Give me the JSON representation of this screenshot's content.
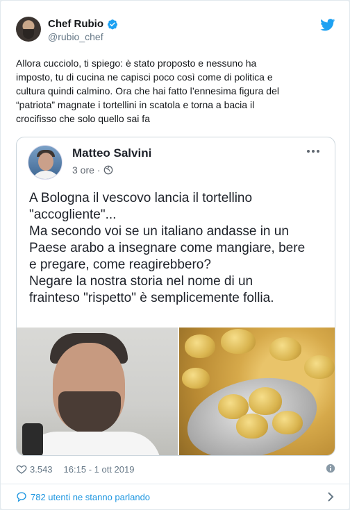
{
  "author": {
    "name": "Chef Rubio",
    "handle": "@rubio_chef",
    "verified": true
  },
  "tweet": {
    "lines": [
      "Allora cucciolo, ti spiego: è stato proposto e nessuno ha",
      "imposto, tu di cucina ne capisci poco così come di politica e",
      "cultura quindi calmino. Ora che hai fatto l’ennesima figura del",
      "“patriota” magnate i tortellini in scatola e torna a bacia il",
      "crocifisso che solo quello sai fa"
    ]
  },
  "embedded_post": {
    "author": "Matteo Salvini",
    "time": "3 ore",
    "separator": "·",
    "lines": [
      "A Bologna il vescovo lancia il tortellino",
      "\"accogliente\"...",
      "Ma secondo voi se un italiano andasse in un",
      "Paese arabo a insegnare come mangiare, bere",
      "e pregare, come reagirebbero?",
      "Negare la nostra storia nel nome di un",
      "frainteso \"rispetto\" è semplicemente follia."
    ]
  },
  "meta": {
    "likes": "3.543",
    "timestamp": "16:15 - 1 ott 2019"
  },
  "footer": {
    "conversation": "782 utenti ne stanno parlando"
  },
  "colors": {
    "twitter_blue": "#1da1f2",
    "link_blue": "#1b95e0",
    "secondary_text": "#657786"
  },
  "icons": [
    "verified-badge-icon",
    "twitter-bird-icon",
    "globe-icon",
    "more-dots-icon",
    "heart-icon",
    "info-icon",
    "speech-bubble-icon",
    "chevron-right-icon"
  ]
}
